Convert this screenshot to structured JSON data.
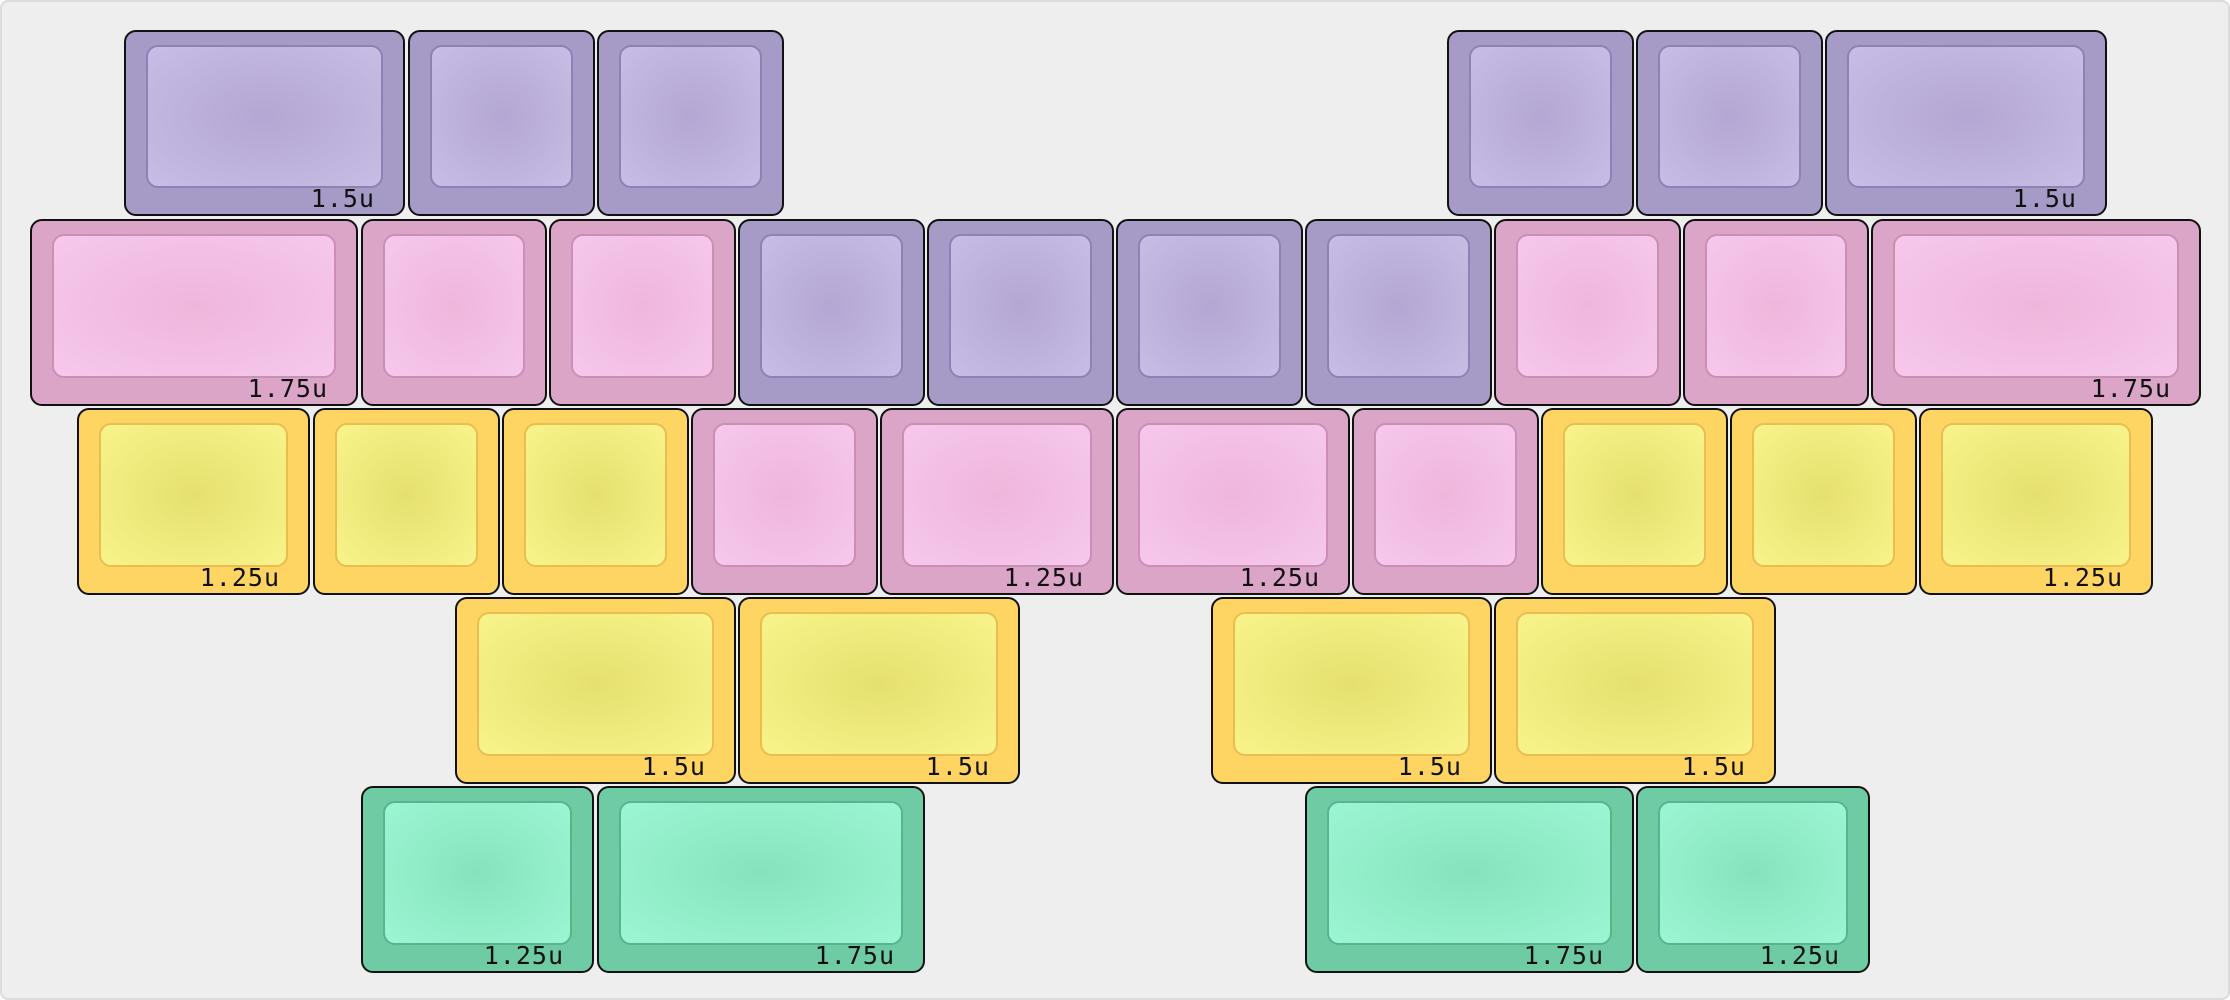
{
  "keyboard": {
    "keys": [
      {
        "color": "purple",
        "size": "1.5u"
      },
      {
        "color": "purple",
        "size": ""
      },
      {
        "color": "purple",
        "size": ""
      },
      {
        "color": "purple",
        "size": ""
      },
      {
        "color": "purple",
        "size": ""
      },
      {
        "color": "purple",
        "size": "1.5u"
      },
      {
        "color": "pink",
        "size": "1.75u"
      },
      {
        "color": "pink",
        "size": ""
      },
      {
        "color": "pink",
        "size": ""
      },
      {
        "color": "purple",
        "size": ""
      },
      {
        "color": "purple",
        "size": ""
      },
      {
        "color": "purple",
        "size": ""
      },
      {
        "color": "purple",
        "size": ""
      },
      {
        "color": "pink",
        "size": ""
      },
      {
        "color": "pink",
        "size": ""
      },
      {
        "color": "pink",
        "size": "1.75u"
      },
      {
        "color": "yellow",
        "size": "1.25u"
      },
      {
        "color": "yellow",
        "size": ""
      },
      {
        "color": "yellow",
        "size": ""
      },
      {
        "color": "pink",
        "size": ""
      },
      {
        "color": "pink",
        "size": "1.25u"
      },
      {
        "color": "pink",
        "size": "1.25u"
      },
      {
        "color": "pink",
        "size": ""
      },
      {
        "color": "yellow",
        "size": ""
      },
      {
        "color": "yellow",
        "size": ""
      },
      {
        "color": "yellow",
        "size": "1.25u"
      },
      {
        "color": "yellow",
        "size": "1.5u"
      },
      {
        "color": "yellow",
        "size": "1.5u"
      },
      {
        "color": "yellow",
        "size": "1.5u"
      },
      {
        "color": "yellow",
        "size": "1.5u"
      },
      {
        "color": "green",
        "size": "1.25u"
      },
      {
        "color": "green",
        "size": "1.75u"
      },
      {
        "color": "green",
        "size": "1.75u"
      },
      {
        "color": "green",
        "size": "1.25u"
      }
    ]
  }
}
